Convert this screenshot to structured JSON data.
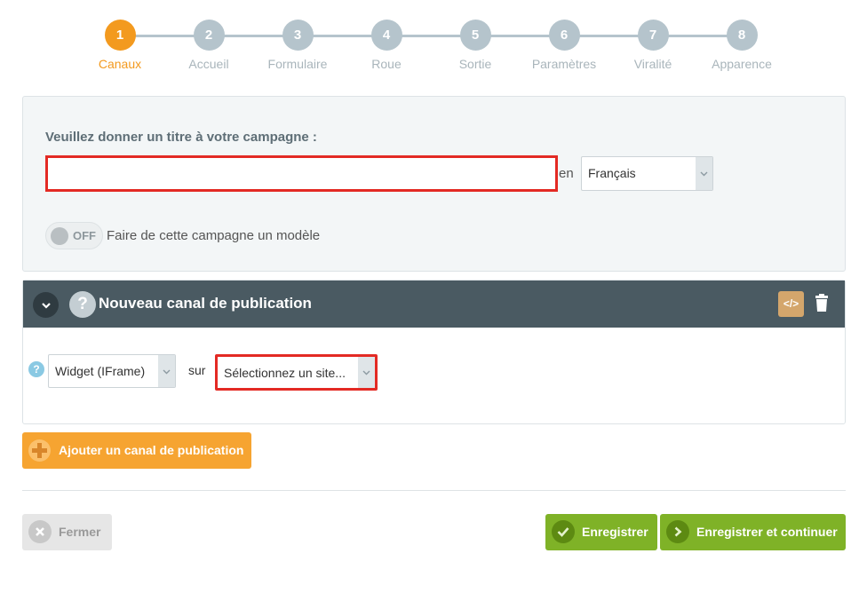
{
  "stepper": {
    "active_index": 0,
    "steps": [
      {
        "number": "1",
        "label": "Canaux"
      },
      {
        "number": "2",
        "label": "Accueil"
      },
      {
        "number": "3",
        "label": "Formulaire"
      },
      {
        "number": "4",
        "label": "Roue"
      },
      {
        "number": "5",
        "label": "Sortie"
      },
      {
        "number": "6",
        "label": "Paramètres"
      },
      {
        "number": "7",
        "label": "Viralité"
      },
      {
        "number": "8",
        "label": "Apparence"
      }
    ]
  },
  "campaign": {
    "title_label": "Veuillez donner un titre à votre campagne :",
    "title_value": "",
    "lang_prefix": "en",
    "language": "Français",
    "template_toggle_state": "OFF",
    "template_toggle_label": "Faire de cette campagne un modèle"
  },
  "channel": {
    "header_title": "Nouveau canal de publication",
    "help_glyph": "?",
    "code_glyph": "</>",
    "type_value": "Widget (IFrame)",
    "on_label": "sur",
    "site_value": "Sélectionnez un site..."
  },
  "actions": {
    "add_channel_label": "Ajouter un canal de publication",
    "close_label": "Fermer",
    "save_label": "Enregistrer",
    "save_continue_label": "Enregistrer et continuer"
  },
  "colors": {
    "accent": "#f39a1f",
    "step_inactive": "#b5c4cc",
    "header_bg": "#4a5a62",
    "error_border": "#e32a24",
    "success": "#7fb227"
  },
  "icons": {
    "collapse": "chevron-down-icon",
    "help": "question-icon",
    "code": "code-icon",
    "delete": "trash-icon",
    "add": "plus-icon",
    "close": "x-icon",
    "save": "check-icon",
    "continue": "arrow-right-icon"
  }
}
